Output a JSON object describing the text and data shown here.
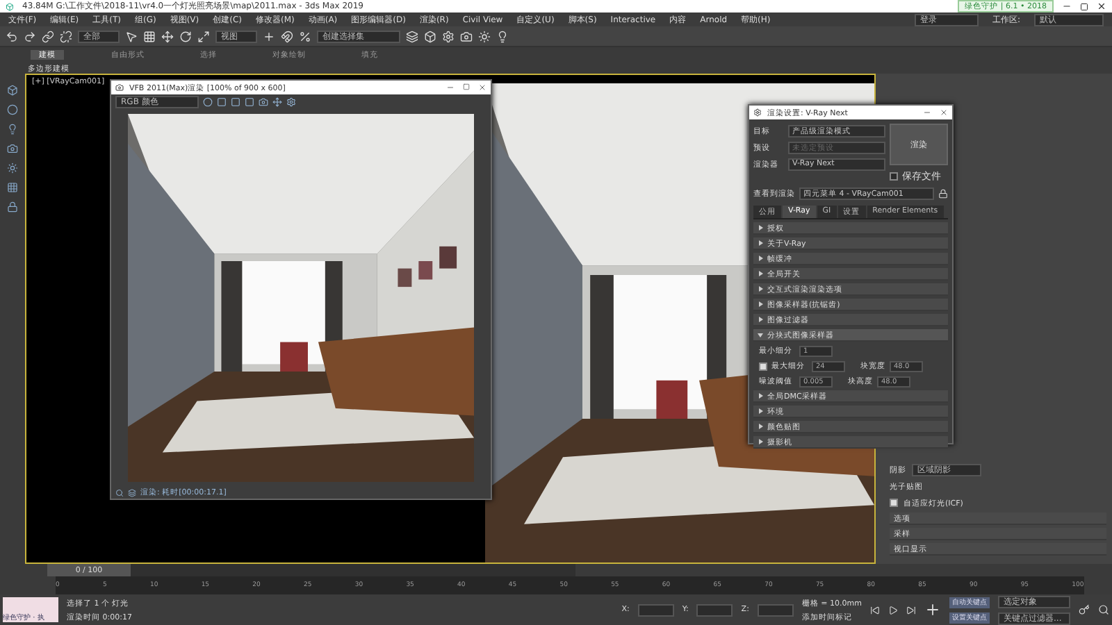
{
  "title_bar": {
    "text": "43.84M   G:\\工作文件\\2018-11\\vr4.0一个灯光照亮场景\\map\\2011.max - 3ds Max 2019",
    "badge": "绿色守护 | 6.1 • 2018"
  },
  "menu": [
    "文件(F)",
    "编辑(E)",
    "工具(T)",
    "组(G)",
    "视图(V)",
    "创建(C)",
    "修改器(M)",
    "动画(A)",
    "图形编辑器(D)",
    "渲染(R)",
    "Civil View",
    "自定义(U)",
    "脚本(S)",
    "Interactive",
    "内容",
    "Arnold",
    "帮助(H)"
  ],
  "workspace": {
    "user": "登录",
    "label": "工作区:",
    "value": "默认"
  },
  "toolbar": {
    "filter": "全部",
    "coord": "视图",
    "named_set": "创建选择集"
  },
  "ribbon": {
    "tabs": [
      {
        "label": "建模",
        "selected": true
      },
      {
        "label": "自由形式",
        "selected": false
      },
      {
        "label": "选择",
        "selected": false
      },
      {
        "label": "对象绘制",
        "selected": false
      },
      {
        "label": "填充",
        "selected": false
      }
    ],
    "sub": "多边形建模"
  },
  "viewport": {
    "label": "[+] [VRayCam001]"
  },
  "frame_buffer": {
    "title": "VFB 2011(Max)渲染 [100% of 900 x 600]",
    "channel": "RGB 颜色",
    "status": "渲染: 耗时[00:00:17.1]"
  },
  "render_setup": {
    "title": "渲染设置: V-Ray Next",
    "render_button": "渲染",
    "fields": [
      {
        "label": "目标",
        "value": "产品级渲染模式",
        "disabled": false
      },
      {
        "label": "预设",
        "value": "未选定预设",
        "disabled": true
      },
      {
        "label": "渲染器",
        "value": "V-Ray Next",
        "disabled": false
      }
    ],
    "save_file": {
      "label": "保存文件",
      "checked": false
    },
    "view": {
      "label": "查看到渲染",
      "value": "四元菜单 4 - VRayCam001"
    },
    "tabs": [
      {
        "label": "公用",
        "selected": false
      },
      {
        "label": "V-Ray",
        "selected": true
      },
      {
        "label": "GI",
        "selected": false
      },
      {
        "label": "设置",
        "selected": false
      },
      {
        "label": "Render Elements",
        "selected": false
      }
    ],
    "rollouts": [
      {
        "label": "授权",
        "expanded": false
      },
      {
        "label": "关于V-Ray",
        "expanded": false
      },
      {
        "label": "帧缓冲",
        "expanded": false
      },
      {
        "label": "全局开关",
        "expanded": false
      },
      {
        "label": "交互式渲染渲染选项",
        "expanded": false
      },
      {
        "label": "图像采样器(抗锯齿)",
        "expanded": false
      },
      {
        "label": "图像过滤器",
        "expanded": false
      },
      {
        "label": "分块式图像采样器",
        "expanded": true,
        "params": [
          {
            "label": "最小细分",
            "value": "1"
          },
          {
            "label": "最大细分",
            "value": "24",
            "checked": true,
            "label2": "块宽度",
            "value2": "48.0"
          },
          {
            "label": "噪波阈值",
            "value": "0.005",
            "label2": "块高度",
            "value2": "48.0"
          }
        ]
      },
      {
        "label": "全局DMC采样器",
        "expanded": false
      },
      {
        "label": "环境",
        "expanded": false
      },
      {
        "label": "颜色贴图",
        "expanded": false
      },
      {
        "label": "摄影机",
        "expanded": false
      }
    ]
  },
  "command_panel": {
    "rows": [
      {
        "label": "阴影",
        "value": "区域阴影"
      },
      {
        "label": "光子贴图"
      }
    ],
    "option": {
      "label": "自适应灯光(ICF)",
      "checked": true
    },
    "rollouts": [
      "选项",
      "采样",
      "视口显示"
    ]
  },
  "timeline": {
    "position": "0 / 100",
    "ticks": [
      "0",
      "5",
      "10",
      "15",
      "20",
      "25",
      "30",
      "35",
      "40",
      "45",
      "50",
      "55",
      "60",
      "65",
      "70",
      "75",
      "80",
      "85",
      "90",
      "95",
      "100"
    ]
  },
  "status_bar": {
    "script": "绿色守护 · 执",
    "message": "选择了 1 个 灯光",
    "render_time": "渲染时间  0:00:17",
    "x": "X:",
    "y": "Y:",
    "z": "Z:",
    "grid": "栅格 = 10.0mm",
    "add_tag": "添加时间标记",
    "auto_key": "自动关键点",
    "selected": "选定对象",
    "set_key": "设置关键点",
    "key_filter": "关键点过滤器..."
  }
}
